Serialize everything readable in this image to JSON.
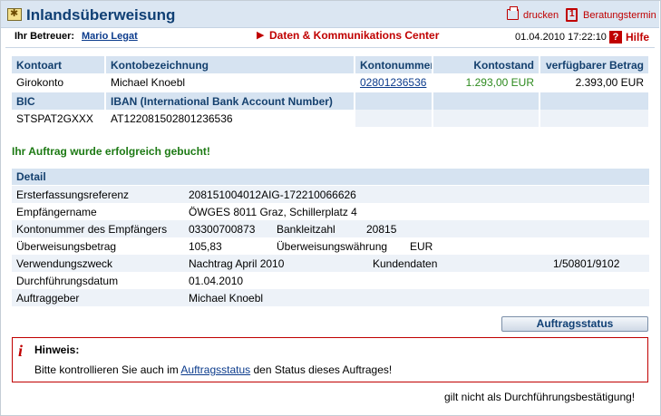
{
  "header": {
    "title": "Inlandsüberweisung",
    "print_label": "drucken",
    "appointment_label": "Beratungstermin"
  },
  "advisor": {
    "label": "Ihr Betreuer:",
    "name": "Mario Legat",
    "center_title": "Daten & Kommunikations Center",
    "datetime": "01.04.2010 17:22:10",
    "help_label": "Hilfe"
  },
  "account": {
    "headers": [
      "Kontoart",
      "Kontobezeichnung",
      "Kontonummer",
      "Kontostand",
      "verfügbarer Betrag"
    ],
    "row": {
      "type": "Girokonto",
      "name": "Michael Knoebl",
      "number": "02801236536",
      "balance": "1.293,00 EUR",
      "available": "2.393,00 EUR"
    },
    "headers2": [
      "BIC",
      "IBAN (International Bank Account Number)"
    ],
    "row2": {
      "bic": "STSPAT2GXXX",
      "iban": "AT122081502801236536"
    }
  },
  "success_message": "Ihr Auftrag wurde erfolgreich gebucht!",
  "detail": {
    "title": "Detail",
    "reference_label": "Ersterfassungsreferenz",
    "reference": "208151004012AIG-172210066626",
    "recipient_label": "Empfängername",
    "recipient": "ÖWGES 8011 Graz, Schillerplatz 4",
    "recipient_account_label": "Kontonummer des Empfängers",
    "recipient_account": "03300700873",
    "bank_code_label": "Bankleitzahl",
    "bank_code": "20815",
    "amount_label": "Überweisungsbetrag",
    "amount": "105,83",
    "currency_label": "Überweisungswährung",
    "currency": "EUR",
    "purpose_label": "Verwendungszweck",
    "purpose": "Nachtrag April 2010",
    "customer_data_label": "Kundendaten",
    "customer_data": "1/50801/9102",
    "execution_date_label": "Durchführungsdatum",
    "execution_date": "01.04.2010",
    "principal_label": "Auftraggeber",
    "principal": "Michael Knoebl"
  },
  "order_status_button": "Auftragsstatus",
  "note": {
    "title": "Hinweis:",
    "text_before": "Bitte kontrollieren Sie auch im ",
    "link": "Auftragsstatus",
    "text_after": " den Status dieses Auftrages!"
  },
  "footer_note": "gilt nicht als Durchführungsbestätigung!",
  "colors": {
    "accent_red": "#c00000",
    "header_blue": "#0f3f74",
    "success_green": "#1d7a14"
  }
}
